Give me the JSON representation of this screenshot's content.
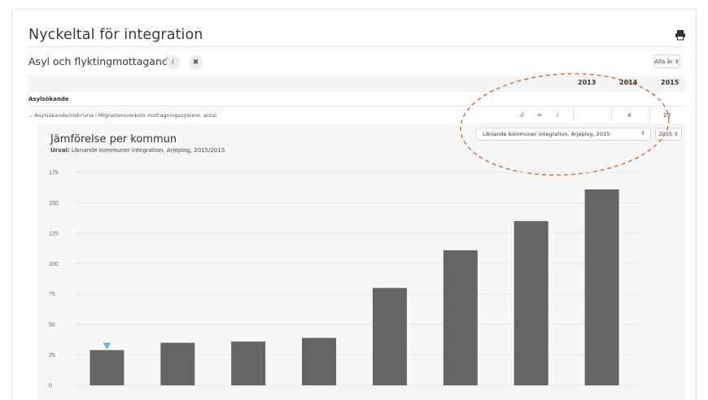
{
  "page": {
    "title": "Nyckeltal för integration"
  },
  "section": {
    "title": "Asyl och flyktingmottagande",
    "info_icon": "i",
    "close_icon": "✖",
    "year_filter": "Alla år ⇕"
  },
  "table": {
    "years": [
      "2013",
      "2014",
      "2015"
    ],
    "group_label": "Asylsökande",
    "row": {
      "label": "⌄ Asylsökande/inskrivna i Migrationsverkets mottagningssystem, antal",
      "icons": [
        "bar-chart-icon",
        "trend-icon",
        "info-icon"
      ],
      "icon_glyphs": [
        ".ıl",
        "≈",
        "i"
      ],
      "values": [
        "",
        "4",
        "29"
      ]
    }
  },
  "comparison": {
    "title": "Jämförelse per kommun",
    "subtitle_label": "Urval:",
    "subtitle_value": "Liknande kommuner integration, Arjeplog, 2015/2015",
    "municipality_select": "Liknande kommuner integration, Arjeplog, 2015",
    "select_arrow": "⇕",
    "year_select": "2015 ⇕"
  },
  "colors": {
    "bar": "#666666",
    "marker": "#5bc0eb",
    "ellipse": "#e05a1e",
    "grid": "#e5e5e5"
  },
  "chart_data": {
    "type": "bar",
    "categories": [
      "",
      "",
      "",
      "",
      "",
      "",
      "",
      ""
    ],
    "values": [
      29,
      35,
      36,
      39,
      80,
      111,
      135,
      161
    ],
    "ylim": [
      0,
      175
    ],
    "yticks": [
      0,
      25,
      50,
      75,
      100,
      125,
      150,
      175
    ],
    "highlight_index": 0,
    "grid": true
  }
}
